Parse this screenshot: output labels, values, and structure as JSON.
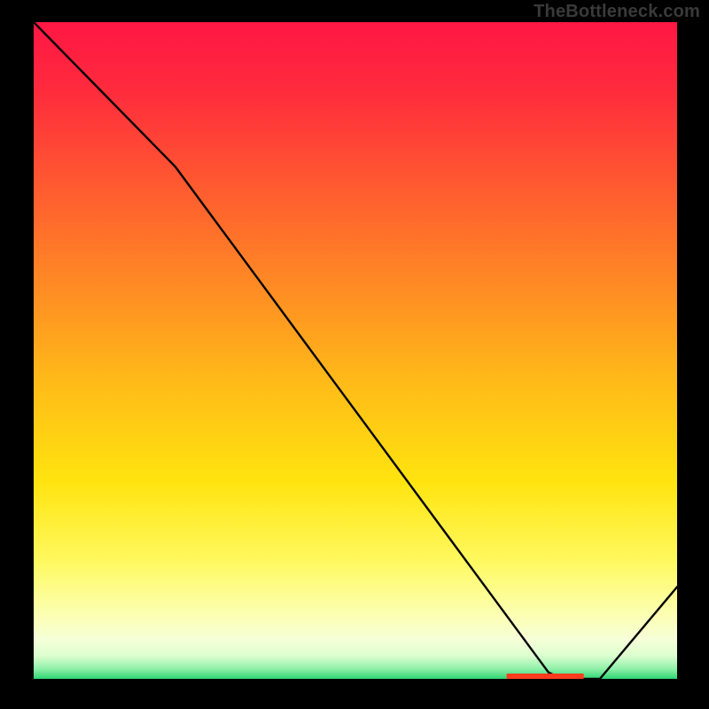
{
  "watermark": "TheBottleneck.com",
  "legend_label": "",
  "chart_data": {
    "type": "line",
    "title": "",
    "xlabel": "",
    "ylabel": "",
    "xlim": [
      0,
      100
    ],
    "ylim": [
      0,
      100
    ],
    "series": [
      {
        "name": "curve",
        "x": [
          0,
          20,
          22,
          80,
          82,
          86,
          88,
          100
        ],
        "values": [
          100,
          80,
          78,
          1,
          0,
          0,
          0,
          14
        ]
      }
    ],
    "legend_marker_x": [
      73.5,
      85.5
    ],
    "gradient_stops": [
      {
        "offset": 0.0,
        "color": "#ff1744"
      },
      {
        "offset": 0.1,
        "color": "#ff2a3d"
      },
      {
        "offset": 0.25,
        "color": "#ff5a30"
      },
      {
        "offset": 0.4,
        "color": "#ff8a24"
      },
      {
        "offset": 0.55,
        "color": "#ffbb18"
      },
      {
        "offset": 0.7,
        "color": "#ffe40f"
      },
      {
        "offset": 0.82,
        "color": "#fff95f"
      },
      {
        "offset": 0.9,
        "color": "#fcffb0"
      },
      {
        "offset": 0.94,
        "color": "#f6ffd8"
      },
      {
        "offset": 0.965,
        "color": "#dcffcf"
      },
      {
        "offset": 0.985,
        "color": "#8ef0a8"
      },
      {
        "offset": 1.0,
        "color": "#2ed573"
      }
    ]
  }
}
